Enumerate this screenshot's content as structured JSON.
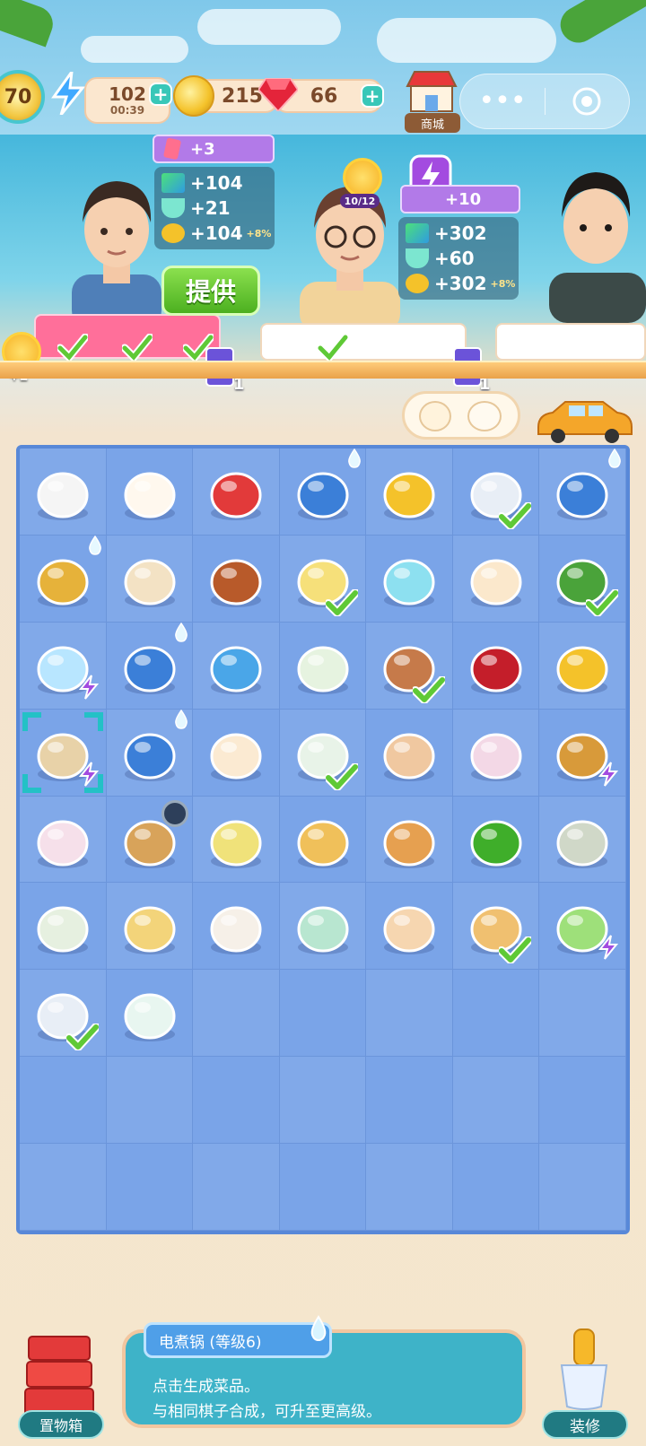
{
  "top_bar": {
    "level": "70",
    "energy": {
      "value": "102",
      "timer": "00:39"
    },
    "coins": "215",
    "gems": "66",
    "shop_label": "商城"
  },
  "customers": [
    {
      "ticket_order": "+3",
      "rewards": {
        "blocks": "+104",
        "tea": "+21",
        "coins": "+104",
        "bonus": "+8%"
      },
      "ticket_count": "1"
    },
    {
      "progress": "10/12",
      "ticket_order": "+10",
      "rewards": {
        "blocks": "+302",
        "tea": "+60",
        "coins": "+302",
        "bonus": "+8%"
      },
      "ticket_count": "1"
    }
  ],
  "provide_button": "提供",
  "sun_bonus": "+2",
  "board": {
    "columns": 7,
    "rows": 9,
    "cells": [
      {
        "icon": "tea-cup-icon",
        "check": false,
        "drop": false,
        "bolt": false
      },
      {
        "icon": "takeout-box-icon",
        "check": false,
        "drop": false,
        "bolt": false
      },
      {
        "icon": "strawberry-icon",
        "check": false,
        "drop": false,
        "bolt": false
      },
      {
        "icon": "treasure-bag-icon",
        "check": false,
        "drop": true,
        "bolt": false
      },
      {
        "icon": "gold-coins-icon",
        "check": false,
        "drop": false,
        "bolt": false
      },
      {
        "icon": "bento-box-icon",
        "check": true,
        "drop": false,
        "bolt": false
      },
      {
        "icon": "treasure-bag-icon",
        "check": false,
        "drop": true,
        "bolt": false
      },
      {
        "icon": "treasure-pile-icon",
        "check": false,
        "drop": true,
        "bolt": false
      },
      {
        "icon": "rice-dish-icon",
        "check": false,
        "drop": false,
        "bolt": false
      },
      {
        "icon": "roast-meat-icon",
        "check": false,
        "drop": false,
        "bolt": false
      },
      {
        "icon": "lemon-tea-icon",
        "check": true,
        "drop": false,
        "bolt": false
      },
      {
        "icon": "bubble-pea-icon",
        "check": false,
        "drop": false,
        "bolt": false
      },
      {
        "icon": "steamed-bun-icon",
        "check": false,
        "drop": false,
        "bolt": false
      },
      {
        "icon": "broccoli-icon",
        "check": true,
        "drop": false,
        "bolt": false
      },
      {
        "icon": "fish-bowl-icon",
        "check": false,
        "drop": false,
        "bolt": true
      },
      {
        "icon": "treasure-bag-icon",
        "check": false,
        "drop": true,
        "bolt": false
      },
      {
        "icon": "fridge-icon",
        "check": false,
        "drop": false,
        "bolt": false
      },
      {
        "icon": "flower-tea-set-icon",
        "check": false,
        "drop": false,
        "bolt": false
      },
      {
        "icon": "ice-cream-bowl-icon",
        "check": true,
        "drop": false,
        "bolt": false
      },
      {
        "icon": "cherry-icon",
        "check": false,
        "drop": false,
        "bolt": false
      },
      {
        "icon": "gold-coins-icon",
        "check": false,
        "drop": false,
        "bolt": false
      },
      {
        "icon": "electric-pot-icon",
        "check": false,
        "drop": false,
        "bolt": true,
        "selected": true
      },
      {
        "icon": "treasure-bag-icon",
        "check": false,
        "drop": true,
        "bolt": false
      },
      {
        "icon": "cream-bun-icon",
        "check": false,
        "drop": false,
        "bolt": false
      },
      {
        "icon": "sake-bottle-icon",
        "check": true,
        "drop": false,
        "bolt": false
      },
      {
        "icon": "popsicle-icon",
        "check": false,
        "drop": false,
        "bolt": false
      },
      {
        "icon": "noodle-bowl-icon",
        "check": false,
        "drop": false,
        "bolt": false
      },
      {
        "icon": "corn-basket-icon",
        "check": false,
        "drop": false,
        "bolt": true
      },
      {
        "icon": "ice-cream-cone-icon",
        "check": false,
        "drop": false,
        "bolt": false
      },
      {
        "icon": "cherry-basket-icon",
        "check": false,
        "drop": false,
        "bolt": false,
        "timer": true
      },
      {
        "icon": "cake-slices-icon",
        "check": false,
        "drop": false,
        "bolt": false
      },
      {
        "icon": "grilled-fish-icon",
        "check": false,
        "drop": false,
        "bolt": false
      },
      {
        "icon": "fried-shrimp-icon",
        "check": false,
        "drop": false,
        "bolt": false
      },
      {
        "icon": "green-pepper-icon",
        "check": false,
        "drop": false,
        "bolt": false
      },
      {
        "icon": "oysters-icon",
        "check": false,
        "drop": false,
        "bolt": false
      },
      {
        "icon": "sake-set-icon",
        "check": false,
        "drop": false,
        "bolt": false
      },
      {
        "icon": "corn-soup-icon",
        "check": false,
        "drop": false,
        "bolt": false
      },
      {
        "icon": "soup-cup-icon",
        "check": false,
        "drop": false,
        "bolt": false
      },
      {
        "icon": "dumpling-bowl-icon",
        "check": false,
        "drop": false,
        "bolt": false
      },
      {
        "icon": "fried-rice-icon",
        "check": false,
        "drop": false,
        "bolt": false
      },
      {
        "icon": "taco-icon",
        "check": true,
        "drop": false,
        "bolt": false
      },
      {
        "icon": "juicer-icon",
        "check": false,
        "drop": false,
        "bolt": true
      },
      {
        "icon": "bento-box-icon",
        "check": true,
        "drop": false,
        "bolt": false
      },
      {
        "icon": "sake-cup-icon",
        "check": false,
        "drop": false,
        "bolt": false
      },
      {
        "icon": "",
        "check": false,
        "drop": false,
        "bolt": false
      },
      {
        "icon": "",
        "check": false,
        "drop": false,
        "bolt": false
      },
      {
        "icon": "",
        "check": false,
        "drop": false,
        "bolt": false
      },
      {
        "icon": "",
        "check": false,
        "drop": false,
        "bolt": false
      },
      {
        "icon": "",
        "check": false,
        "drop": false,
        "bolt": false
      }
    ]
  },
  "bottom": {
    "storage_label": "置物箱",
    "item_title": "电煮锅 (等级6)",
    "item_desc_1": "点击生成菜品。",
    "item_desc_2": "与相同棋子合成，可升至更高级。",
    "repair_label": "装修"
  },
  "colors": {
    "board_bg": "#7aa4e8",
    "check_green": "#5fc936",
    "bolt_purple": "#a34be0"
  }
}
